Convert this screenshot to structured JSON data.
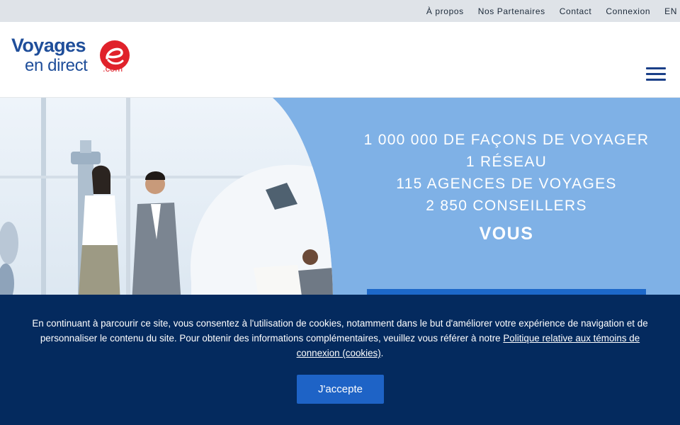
{
  "topnav": {
    "items": [
      "À propos",
      "Nos Partenaires",
      "Contact",
      "Connexion",
      "EN"
    ]
  },
  "logo": {
    "line1": "Voyages",
    "line2": "en direct",
    "suffix": ".com",
    "primary_color": "#1f4e9a",
    "accent_color": "#e0222b"
  },
  "menu": {
    "icon": "hamburger-menu-icon"
  },
  "hero": {
    "lines": [
      "1 000 000 DE FAÇONS DE VOYAGER",
      "1 RÉSEAU",
      "115 AGENCES DE VOYAGES",
      "2 850 CONSEILLERS"
    ],
    "emphasis": "VOUS",
    "background_color": "#7fb1e6"
  },
  "cookie_banner": {
    "text": "En continuant à parcourir ce site, vous consentez à l'utilisation de cookies, notamment dans le but d'améliorer votre expérience de navigation et de personnaliser le contenu du site. Pour obtenir des informations complémentaires, veuillez vous référer à notre ",
    "link_text": "Politique relative aux témoins de connexion (cookies)",
    "end": ".",
    "accept_label": "J'accepte",
    "background_color": "#042a5e"
  }
}
